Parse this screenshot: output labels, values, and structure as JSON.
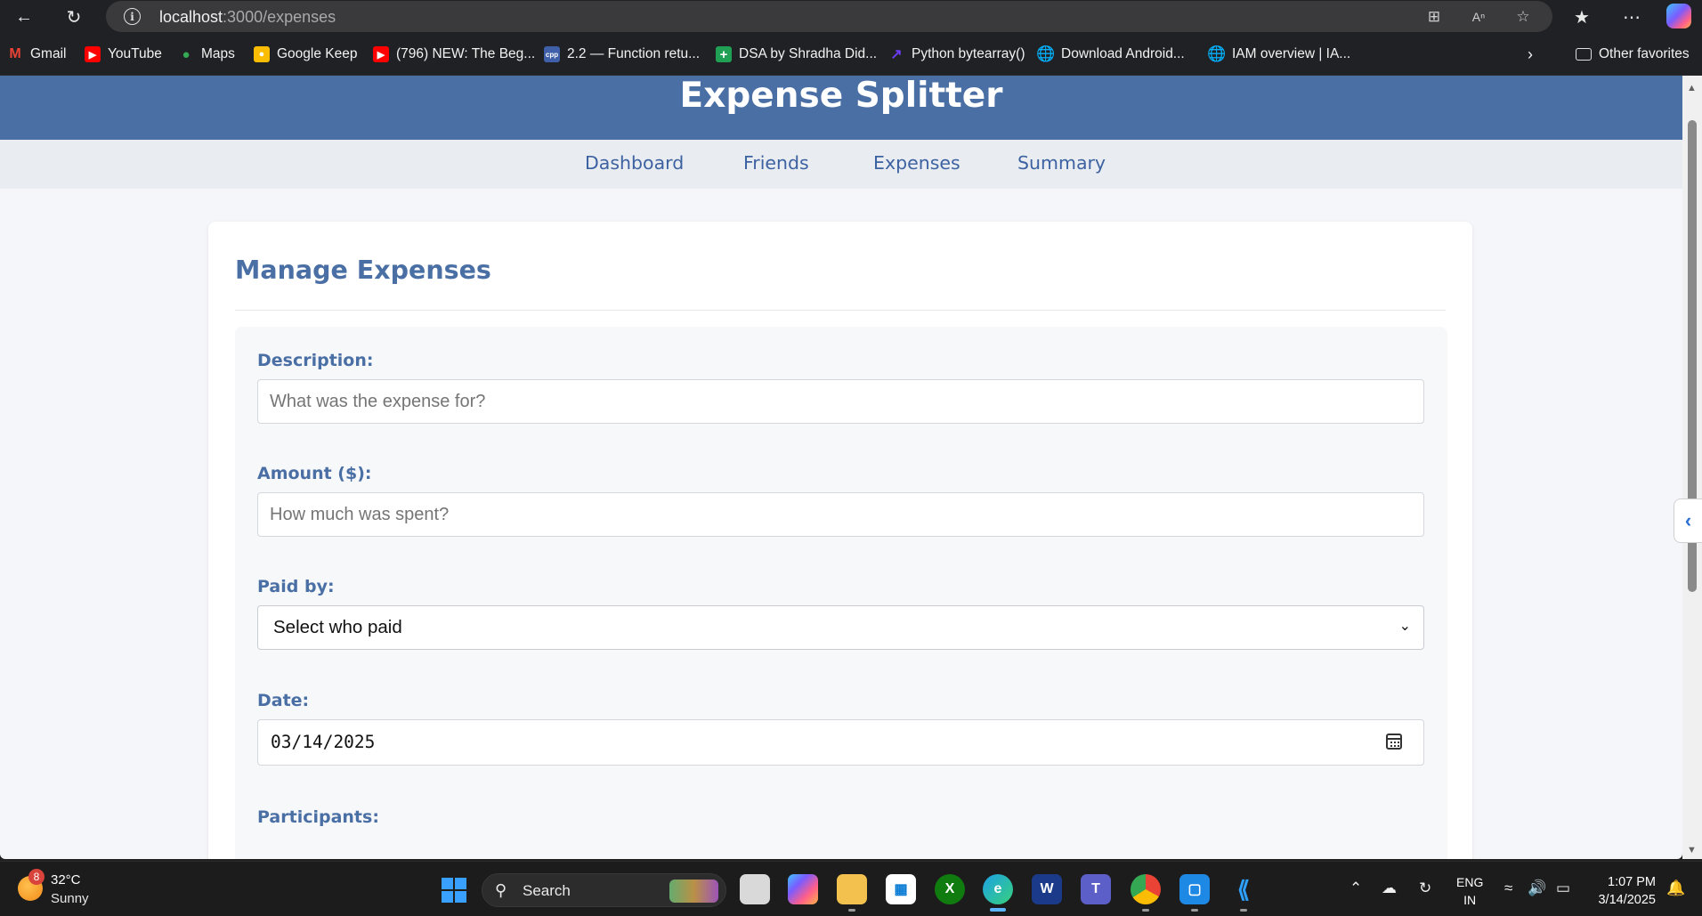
{
  "browser": {
    "url_host": "localhost",
    "url_path": ":3000/expenses",
    "favorites": [
      {
        "label": "Gmail",
        "icon": "gmail-icon",
        "color": "#ea4335"
      },
      {
        "label": "YouTube",
        "icon": "youtube-icon",
        "color": "#ff0000"
      },
      {
        "label": "Maps",
        "icon": "maps-icon",
        "color": "#34a853"
      },
      {
        "label": "Google Keep",
        "icon": "keep-icon",
        "color": "#fbbc04"
      },
      {
        "label": "(796) NEW: The Beg...",
        "icon": "youtube-icon",
        "color": "#ff0000"
      },
      {
        "label": "2.2 — Function retu...",
        "icon": "cpp-icon",
        "color": "#3f5fa8"
      },
      {
        "label": "DSA by Shradha Did...",
        "icon": "plus-icon",
        "color": "#1fa055"
      },
      {
        "label": "Python bytearray()",
        "icon": "programiz-icon",
        "color": "#6b3cf0"
      },
      {
        "label": "Download Android...",
        "icon": "globe-icon",
        "color": "#202124"
      },
      {
        "label": "IAM overview | IA...",
        "icon": "globe-icon",
        "color": "#202124"
      }
    ],
    "other_favorites": "Other favorites"
  },
  "app": {
    "title": "Expense Splitter",
    "nav": [
      "Dashboard",
      "Friends",
      "Expenses",
      "Summary"
    ]
  },
  "form": {
    "heading": "Manage Expenses",
    "description_label": "Description:",
    "description_placeholder": "What was the expense for?",
    "amount_label": "Amount ($):",
    "amount_placeholder": "How much was spent?",
    "paid_by_label": "Paid by:",
    "paid_by_value": "Select who paid",
    "date_label": "Date:",
    "date_value": "03/14/2025",
    "participants_label": "Participants:"
  },
  "taskbar": {
    "weather_badge": "8",
    "temperature": "32°C",
    "condition": "Sunny",
    "search_label": "Search",
    "lang_top": "ENG",
    "lang_bottom": "IN",
    "time": "1:07 PM",
    "date": "3/14/2025"
  },
  "colors": {
    "header": "#4a6fa5",
    "accent_text": "#4a6fa5",
    "nav_bg": "#e9ecf0",
    "page_bg": "#f4f6f9"
  }
}
